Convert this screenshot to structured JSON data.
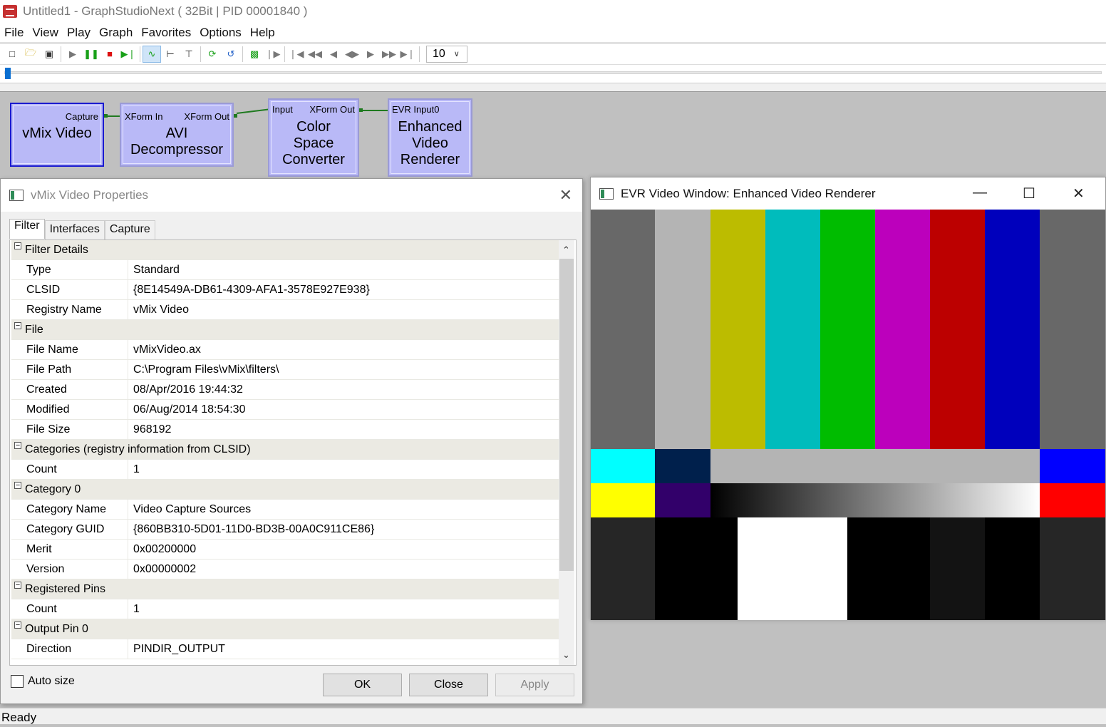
{
  "window": {
    "title": "Untitled1 - GraphStudioNext ( 32Bit | PID 00001840 )"
  },
  "menu": [
    "File",
    "View",
    "Play",
    "Graph",
    "Favorites",
    "Options",
    "Help"
  ],
  "toolbar": {
    "zoom_value": "10"
  },
  "graph": {
    "filters": [
      {
        "name_lines": [
          "vMix Video"
        ],
        "in_pin": "",
        "out_pin": "Capture"
      },
      {
        "name_lines": [
          "AVI",
          "Decompressor"
        ],
        "in_pin": "XForm In",
        "out_pin": "XForm Out"
      },
      {
        "name_lines": [
          "Color",
          "Space",
          "Converter"
        ],
        "in_pin": "Input",
        "out_pin": "XForm Out"
      },
      {
        "name_lines": [
          "Enhanced",
          "Video",
          "Renderer"
        ],
        "in_pin": "EVR Input0",
        "out_pin": ""
      }
    ]
  },
  "dialog": {
    "title": "vMix Video Properties",
    "tabs": [
      "Filter",
      "Interfaces",
      "Capture"
    ],
    "rows": [
      {
        "type": "cat",
        "label": "Filter Details"
      },
      {
        "type": "prop",
        "name": "Type",
        "value": "Standard"
      },
      {
        "type": "prop",
        "name": "CLSID",
        "value": "{8E14549A-DB61-4309-AFA1-3578E927E938}"
      },
      {
        "type": "prop",
        "name": "Registry Name",
        "value": "vMix Video"
      },
      {
        "type": "cat",
        "label": "File"
      },
      {
        "type": "prop",
        "name": "File Name",
        "value": "vMixVideo.ax"
      },
      {
        "type": "prop",
        "name": "File Path",
        "value": "C:\\Program Files\\vMix\\filters\\"
      },
      {
        "type": "prop",
        "name": "Created",
        "value": "08/Apr/2016  19:44:32"
      },
      {
        "type": "prop",
        "name": "Modified",
        "value": "06/Aug/2014  18:54:30"
      },
      {
        "type": "prop",
        "name": "File Size",
        "value": "968192"
      },
      {
        "type": "cat",
        "label": "Categories (registry information from CLSID)"
      },
      {
        "type": "prop",
        "name": "Count",
        "value": "1"
      },
      {
        "type": "cat",
        "label": "Category 0"
      },
      {
        "type": "prop",
        "name": "Category Name",
        "value": "Video Capture Sources"
      },
      {
        "type": "prop",
        "name": "Category GUID",
        "value": "{860BB310-5D01-11D0-BD3B-00A0C911CE86}"
      },
      {
        "type": "prop",
        "name": "Merit",
        "value": "0x00200000"
      },
      {
        "type": "prop",
        "name": "Version",
        "value": "0x00000002"
      },
      {
        "type": "cat",
        "label": "Registered Pins"
      },
      {
        "type": "prop",
        "name": "Count",
        "value": "1"
      },
      {
        "type": "cat",
        "label": "Output Pin 0"
      },
      {
        "type": "prop",
        "name": "Direction",
        "value": "PINDIR_OUTPUT"
      }
    ],
    "autosize_label": "Auto size",
    "ok_label": "OK",
    "close_label": "Close",
    "apply_label": "Apply"
  },
  "evr": {
    "title": "EVR Video Window: Enhanced Video Renderer",
    "bars_top": [
      "#686868",
      "#b4b4b4",
      "#bcbc00",
      "#00bcbc",
      "#00bc00",
      "#bc00bc",
      "#bc0000",
      "#0000bc",
      "#686868"
    ],
    "bars_mid_colors": [
      "#00ffff",
      "#00204c",
      "#b4b4b4",
      "#0000ff"
    ],
    "bars_low_colors": [
      "#ffff00",
      "#32006a",
      "#ff0000"
    ],
    "bars_bottom_colors": [
      "#262626",
      "#000000",
      "#ffffff",
      "#000000",
      "#131313",
      "#000000",
      "#262626"
    ]
  },
  "status": "Ready"
}
